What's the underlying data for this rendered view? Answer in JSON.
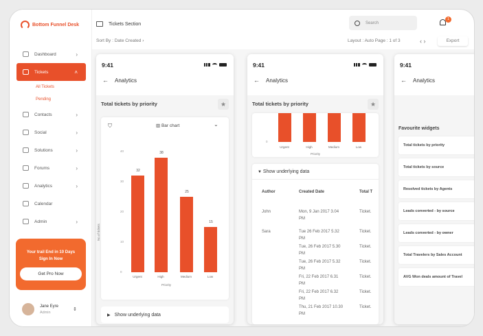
{
  "brand": {
    "name": "Bottom Funnel Desk",
    "color": "#e8502a"
  },
  "sidebar": {
    "items": [
      {
        "label": "Dashboard",
        "icon": "dashboard-icon"
      },
      {
        "label": "Tickets",
        "icon": "ticket-icon",
        "active": true
      },
      {
        "label": "Contacts",
        "icon": "contacts-icon"
      },
      {
        "label": "Social",
        "icon": "social-icon"
      },
      {
        "label": "Solutions",
        "icon": "solutions-icon"
      },
      {
        "label": "Forums",
        "icon": "forums-icon"
      },
      {
        "label": "Analytics",
        "icon": "analytics-icon"
      },
      {
        "label": "Calendar",
        "icon": "calendar-icon"
      },
      {
        "label": "Admin",
        "icon": "admin-icon"
      }
    ],
    "subitems": [
      "All Tickets",
      "Pending"
    ],
    "promo": {
      "line1": "Your trail End in 10 Days",
      "line2": "Sign In Now",
      "button": "Get Pro Now"
    },
    "user": {
      "name": "Jane Eyre",
      "role": "Admin"
    }
  },
  "header": {
    "title": "Tickets Section",
    "search_placeholder": "Search",
    "notification_count": "1",
    "sort": "Sort By : Date Created",
    "layout": "Layout : Auto",
    "page": "Page : 1 of 3",
    "export": "Export"
  },
  "phones": {
    "time": "9:41",
    "screen_title": "Analytics",
    "card_title": "Total tickets by priority",
    "chart_type_label": "Bar chart",
    "show_data_label": "Show underlying data",
    "favourites_title": "Favourite widgets"
  },
  "chart_data": {
    "type": "bar",
    "categories": [
      "Urgent",
      "High",
      "Medium",
      "Low"
    ],
    "values": [
      32,
      38,
      25,
      15
    ],
    "xlabel": "Priority",
    "ylabel": "No.of tickets",
    "yticks": [
      "0",
      "10",
      "20",
      "30",
      "40"
    ]
  },
  "table": {
    "headers": [
      "Author",
      "Created Date",
      "Total T"
    ],
    "rows": [
      {
        "author": "John",
        "dates": [
          "Mon, 9 Jan 2017 3.04",
          "PM"
        ],
        "total": [
          "Ticket."
        ]
      },
      {
        "author": "Sara",
        "dates": [
          "Tue  26 Feb 2017 5.32",
          "PM",
          "Tue, 26 Feb 2017 5.30",
          "PM",
          "Tue, 26 Feb 2017 5.32",
          "PM",
          "Fri, 22 Feb 2017 6.31",
          "PM",
          "Fri, 22 Feb 2017 6.32",
          "PM",
          "Thu, 21 Feb 2017 10.30",
          "PM"
        ],
        "total": [
          "Ticket.",
          "Ticket.",
          "Ticket.",
          "Ticket.",
          "Ticket.",
          "Ticket."
        ]
      }
    ]
  },
  "widgets": [
    "Total tickets by priority",
    "Total tickets by source",
    "Resolved tickets by Agents",
    "Leads converted - by source",
    "Leads converted - by owner",
    "Total Travelers by Sales Account",
    "AVG Won deals amount of Travel"
  ]
}
